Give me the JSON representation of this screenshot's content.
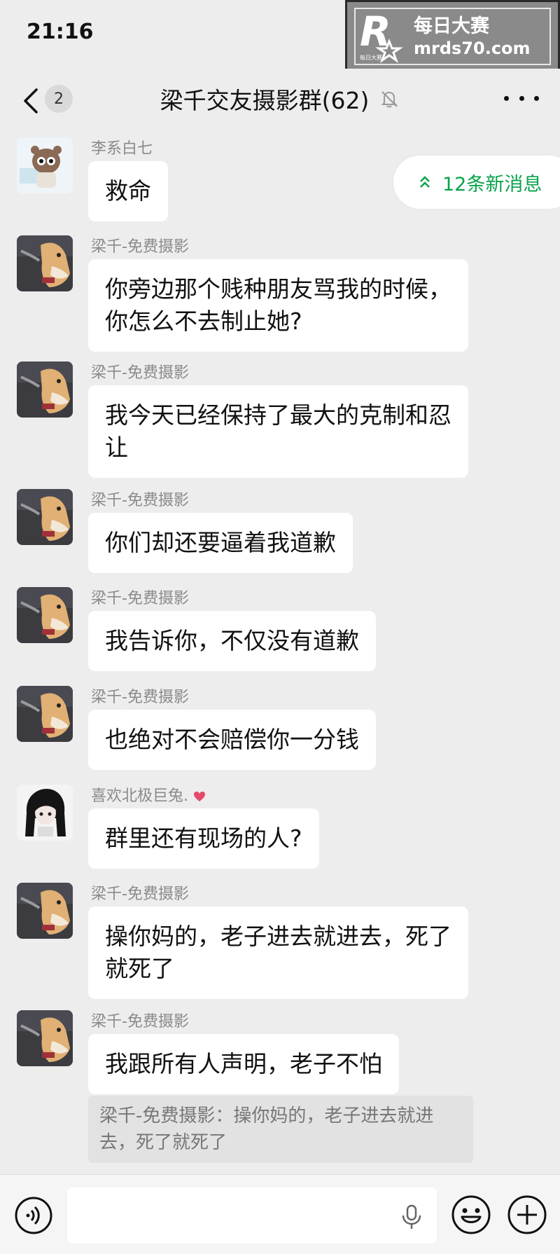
{
  "status": {
    "time": "21:16"
  },
  "watermark": {
    "title": "每日大赛",
    "url": "mrds70.com",
    "logo_small_text": "每日大赛"
  },
  "header": {
    "back_badge": "2",
    "title": "梁千交友摄影群(62)",
    "icons": [
      "back-chevron-icon",
      "bell-muted-icon",
      "more-dots-icon"
    ]
  },
  "new_messages_pill": {
    "label": "12条新消息",
    "color": "#07a34a"
  },
  "messages": [
    {
      "sender": "李系白七",
      "lines": [
        "救命"
      ],
      "avatar": "cartoon-character"
    },
    {
      "sender": "梁千-免费摄影",
      "lines": [
        "你旁边那个贱种朋友骂我的时候，",
        "你怎么不去制止她?"
      ],
      "avatar": "dog-photo"
    },
    {
      "sender": "梁千-免费摄影",
      "lines": [
        "我今天已经保持了最大的克制和忍",
        "让"
      ],
      "avatar": "dog-photo"
    },
    {
      "sender": "梁千-免费摄影",
      "lines": [
        "你们却还要逼着我道歉"
      ],
      "avatar": "dog-photo"
    },
    {
      "sender": "梁千-免费摄影",
      "lines": [
        "我告诉你，不仅没有道歉"
      ],
      "avatar": "dog-photo"
    },
    {
      "sender": "梁千-免费摄影",
      "lines": [
        "也绝对不会赔偿你一分钱"
      ],
      "avatar": "dog-photo"
    },
    {
      "sender": "喜欢北极巨兔.",
      "lines": [
        "群里还有现场的人?"
      ],
      "avatar": "anime-girl"
    },
    {
      "sender": "梁千-免费摄影",
      "lines": [
        "操你妈的，老子进去就进去，死了",
        "就死了"
      ],
      "avatar": "dog-photo"
    },
    {
      "sender": "梁千-免费摄影",
      "lines": [
        "我跟所有人声明，老子不怕"
      ],
      "avatar": "dog-photo"
    }
  ],
  "quote": {
    "lines": [
      "梁千-免费摄影：操你妈的，老子进去就进",
      "去，死了就死了"
    ]
  },
  "input_bar": {
    "placeholder": "",
    "icons": [
      "voice-icon",
      "mic-icon",
      "emoji-icon",
      "plus-icon"
    ]
  },
  "colors": {
    "background": "#ededed",
    "bubble": "#ffffff",
    "accent_green": "#07a34a"
  }
}
